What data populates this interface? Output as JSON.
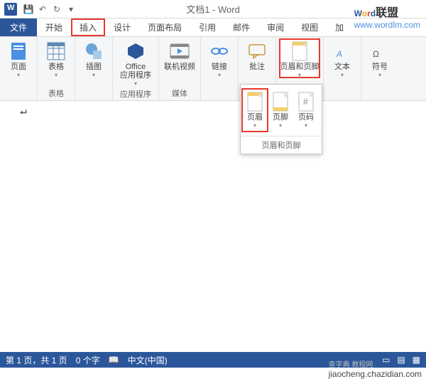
{
  "title": "文档1 - Word",
  "qat": {
    "save": "💾",
    "undo": "↶",
    "redo": "↻",
    "more": "▾"
  },
  "brand": {
    "word": "Word",
    "union": "联盟",
    "url": "www.wordlm.com"
  },
  "tabs": {
    "file": "文件",
    "start": "开始",
    "insert": "插入",
    "design": "设计",
    "layout": "页面布局",
    "ref": "引用",
    "mail": "邮件",
    "review": "审阅",
    "view": "视图",
    "more": "加"
  },
  "ribbon": {
    "pages": {
      "label": "页面",
      "btn": "页面"
    },
    "tables": {
      "label": "表格",
      "btn": "表格"
    },
    "illus": {
      "btn": "插图"
    },
    "apps": {
      "label": "应用程序",
      "btn": "Office\n应用程序"
    },
    "media": {
      "label": "媒体",
      "btn": "联机视频"
    },
    "links": {
      "btn": "链接"
    },
    "comments": {
      "label": "批注",
      "btn": "批注"
    },
    "headerfooter": {
      "label": "",
      "btn": "页眉和页脚"
    },
    "text": {
      "btn": "文本"
    },
    "symbols": {
      "btn": "符号"
    }
  },
  "dropdown": {
    "header": "页眉",
    "footer": "页脚",
    "pagenum": "页码",
    "group": "页眉和页脚"
  },
  "status": {
    "page": "第 1 页，共 1 页",
    "words": "0 个字",
    "lang": "中文(中国)"
  },
  "footer_wm": "jiaocheng.chazidian.com"
}
